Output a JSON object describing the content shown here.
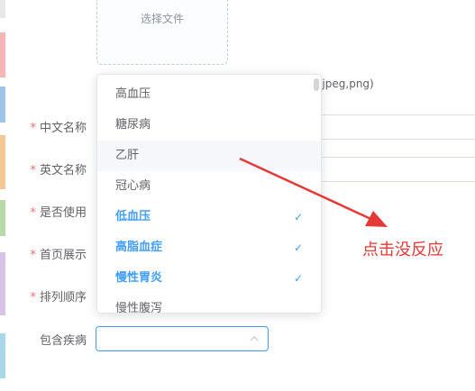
{
  "upload": {
    "button_label": "选择文件",
    "tip": "g,jpeg,png)"
  },
  "form": {
    "fields": [
      {
        "label": "中文名称",
        "required": true
      },
      {
        "label": "英文名称",
        "required": true
      },
      {
        "label": "是否使用",
        "required": true
      },
      {
        "label": "首页展示",
        "required": true
      },
      {
        "label": "排列顺序",
        "required": true
      },
      {
        "label": "包含疾病",
        "required": false
      }
    ],
    "required_mark": "*"
  },
  "dropdown": {
    "options": [
      {
        "label": "高血压",
        "selected": false
      },
      {
        "label": "糖尿病",
        "selected": false
      },
      {
        "label": "乙肝",
        "selected": false,
        "hovered": true
      },
      {
        "label": "冠心病",
        "selected": false
      },
      {
        "label": "低血压",
        "selected": true
      },
      {
        "label": "高脂血症",
        "selected": true
      },
      {
        "label": "慢性胃炎",
        "selected": true
      },
      {
        "label": "慢性腹泻",
        "selected": false
      }
    ],
    "check_icon": "check-icon",
    "select_arrow_icon": "chevron-up-icon"
  },
  "annotation": {
    "text": "点击没反应",
    "color": "#e53935"
  },
  "colors": {
    "accent": "#409eff",
    "required": "#f56c6c"
  }
}
